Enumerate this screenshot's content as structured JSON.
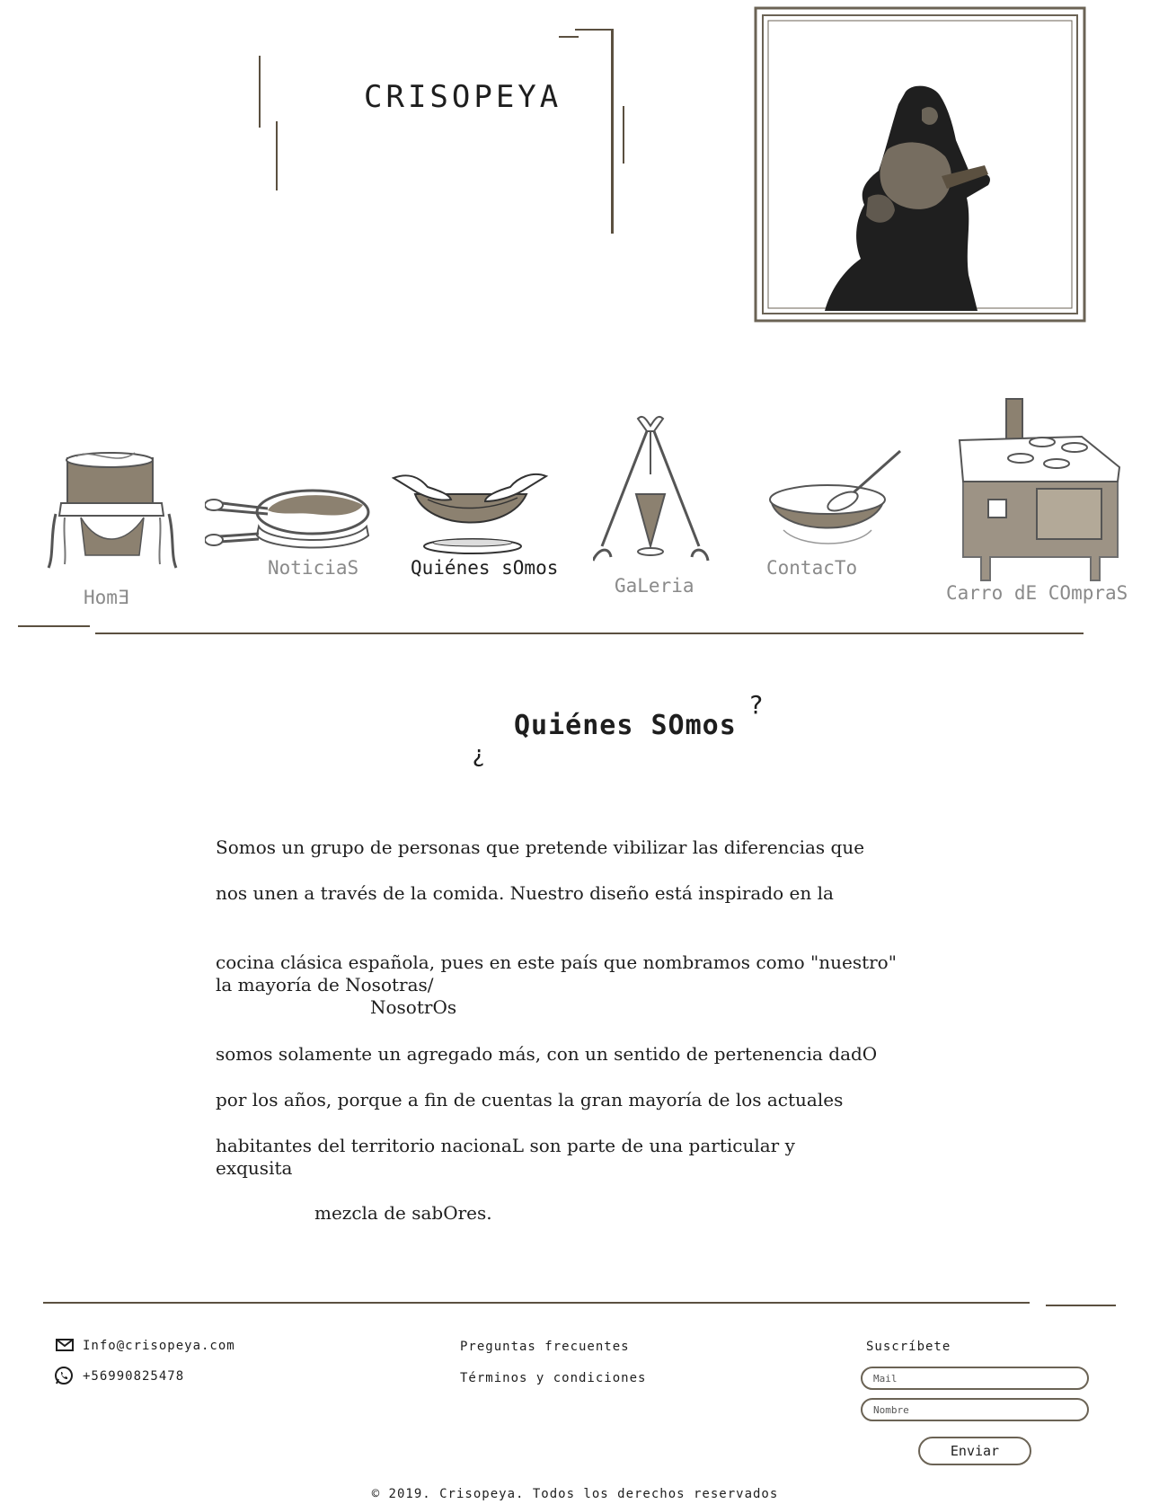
{
  "brand": {
    "logo_text": "CRISOPEYA"
  },
  "nav": {
    "items": [
      {
        "label": "HomƎ",
        "icon": "cooking-pot-on-stove-icon",
        "active": false
      },
      {
        "label": "NoticiaS",
        "icon": "frying-pan-icon",
        "active": false
      },
      {
        "label": "Quiénes sOmos",
        "icon": "hands-bowl-icon",
        "active": true
      },
      {
        "label": "GaLeria",
        "icon": "tripod-cone-icon",
        "active": false
      },
      {
        "label": "ContacTo",
        "icon": "mixing-bowl-spoon-icon",
        "active": false
      },
      {
        "label": "Carro dE COmpraS",
        "icon": "wood-stove-icon",
        "active": false
      }
    ]
  },
  "main": {
    "title_open": "¿",
    "title": "Quiénes SOmos",
    "title_close": "?",
    "paragraphs": [
      "Somos un grupo de personas que pretende vibilizar las diferencias que",
      "nos unen a través de la comida. Nuestro diseño está inspirado en la",
      "cocina clásica española, pues en este país que nombramos como \"nuestro\"",
      "la mayoría de Nosotras/",
      "NosotrOs",
      "somos solamente un agregado más, con un sentido de pertenencia dadO",
      "por los años, porque a fin de cuentas la gran mayoría de los actuales",
      "habitantes del territorio nacionaL son parte de una particular y",
      "exqusita",
      "mezcla de sabOres."
    ]
  },
  "footer": {
    "email": "Info@crisopeya.com",
    "phone": "+56990825478",
    "links": [
      "Preguntas frecuentes",
      "Términos y condiciones"
    ],
    "subscribe_title": "Suscríbete",
    "mail_placeholder": "Mail",
    "name_placeholder": "Nombre",
    "send_label": "Enviar",
    "copyright": "©  2019. Crisopeya. Todos los derechos reservados"
  },
  "colors": {
    "accent": "#8c8170",
    "line": "#5b5040",
    "text": "#1e1e1e",
    "inactive": "#8a8a8a"
  }
}
